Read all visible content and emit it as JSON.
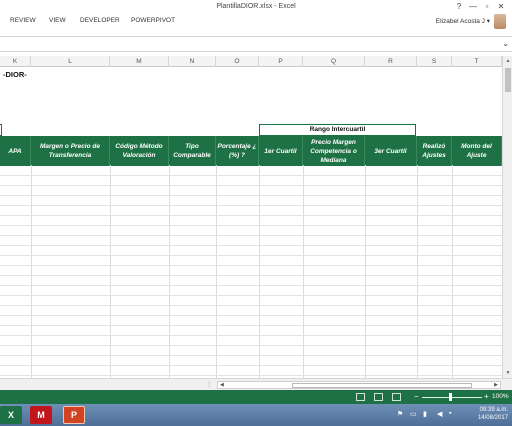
{
  "window": {
    "title": "PlantillaDIOR.xlsx - Excel",
    "min_label": "?",
    "restore_label": "—",
    "max_label": "▫",
    "close_label": "✕"
  },
  "ribbon": {
    "tabs": [
      "REVIEW",
      "VIEW",
      "DEVELOPER",
      "POWERPIVOT"
    ],
    "user_name": "Elizabel Acosta J",
    "user_chevron": "▾"
  },
  "formula_bar": {
    "expand": "⌄"
  },
  "columns": [
    "K",
    "L",
    "M",
    "N",
    "O",
    "P",
    "Q",
    "R",
    "S",
    "T"
  ],
  "sheet": {
    "dior_label": "-DIOR-",
    "rango_label": "Rango Intercuartil",
    "headers": [
      "APA",
      "Margen o Precio de Transferencia",
      "Código Método Valoración",
      "Tipo Comparable",
      "Porcentaje ¿ (%) ?",
      "1er Cuartil",
      "Precio Margen Competencia o Mediana",
      "3er Cuartil",
      "Realizó Ajustes",
      "Monto del Ajuste"
    ]
  },
  "status_bar": {
    "zoom": "100%",
    "zoom_minus": "−",
    "zoom_plus": "+"
  },
  "taskbar": {
    "excel_label": "X",
    "mcafee_label": "M",
    "ppt_label": "P",
    "time": "09:39 a.m.",
    "date": "14/08/2017"
  },
  "colors": {
    "accent": "#1e7145",
    "taskbar": "#5a7ca7"
  }
}
